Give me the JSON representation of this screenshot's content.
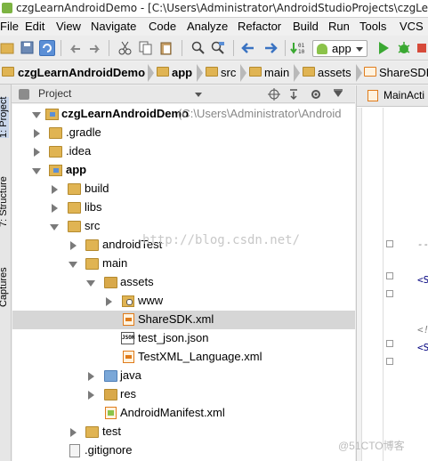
{
  "window": {
    "title": "czgLearnAndroidDemo - [C:\\Users\\Administrator\\AndroidStudioProjects\\czgLea"
  },
  "menu": [
    {
      "label": "File"
    },
    {
      "label": "Edit"
    },
    {
      "label": "View"
    },
    {
      "label": "Navigate"
    },
    {
      "label": "Code"
    },
    {
      "label": "Analyze"
    },
    {
      "label": "Refactor"
    },
    {
      "label": "Build"
    },
    {
      "label": "Run"
    },
    {
      "label": "Tools"
    },
    {
      "label": "VCS"
    }
  ],
  "toolbar": {
    "run_config": "app",
    "icons": [
      "open-folder-icon",
      "save-icon",
      "sync-icon",
      "undo-icon",
      "redo-icon",
      "cut-icon",
      "copy-icon",
      "paste-icon",
      "find-icon",
      "replace-icon",
      "back-icon",
      "forward-icon",
      "make-project-icon",
      "run-icon",
      "debug-icon"
    ]
  },
  "breadcrumb": [
    {
      "label": "czgLearnAndroidDemo",
      "bold": true
    },
    {
      "label": "app",
      "bold": true
    },
    {
      "label": "src",
      "bold": false
    },
    {
      "label": "main",
      "bold": false
    },
    {
      "label": "assets",
      "bold": false
    },
    {
      "label": "ShareSDK.",
      "bold": false
    }
  ],
  "sidetabs": {
    "project": "1: Project",
    "structure": "7: Structure",
    "captures": "Captures"
  },
  "panel": {
    "view_mode": "Project"
  },
  "tree": [
    {
      "label": "czgLearnAndroidDemo",
      "hint": "(C:\\Users\\Administrator\\Android",
      "bold": true,
      "depth": 0,
      "expand": "open",
      "icon": "module"
    },
    {
      "label": ".gradle",
      "depth": 1,
      "expand": "closed",
      "icon": "folder"
    },
    {
      "label": ".idea",
      "depth": 1,
      "expand": "closed",
      "icon": "folder"
    },
    {
      "label": "app",
      "bold": true,
      "depth": 1,
      "expand": "open",
      "icon": "module"
    },
    {
      "label": "build",
      "depth": 2,
      "expand": "closed",
      "icon": "folder"
    },
    {
      "label": "libs",
      "depth": 2,
      "expand": "closed",
      "icon": "folder"
    },
    {
      "label": "src",
      "depth": 2,
      "expand": "open",
      "icon": "folder"
    },
    {
      "label": "androidTest",
      "depth": 3,
      "expand": "closed",
      "icon": "folder"
    },
    {
      "label": "main",
      "depth": 3,
      "expand": "open",
      "icon": "folder"
    },
    {
      "label": "assets",
      "depth": 4,
      "expand": "open",
      "icon": "res"
    },
    {
      "label": "www",
      "depth": 5,
      "expand": "closed",
      "icon": "www"
    },
    {
      "label": "ShareSDK.xml",
      "depth": 5,
      "expand": "none",
      "icon": "xml",
      "selected": true
    },
    {
      "label": "test_json.json",
      "depth": 5,
      "expand": "none",
      "icon": "json"
    },
    {
      "label": "TestXML_Language.xml",
      "depth": 5,
      "expand": "none",
      "icon": "xml"
    },
    {
      "label": "java",
      "depth": 4,
      "expand": "closed",
      "icon": "java"
    },
    {
      "label": "res",
      "depth": 4,
      "expand": "closed",
      "icon": "res"
    },
    {
      "label": "AndroidManifest.xml",
      "depth": 4,
      "expand": "none",
      "icon": "manifest"
    },
    {
      "label": "test",
      "depth": 3,
      "expand": "closed",
      "icon": "folder"
    },
    {
      "label": ".gitignore",
      "depth": 2,
      "expand": "none",
      "icon": "gitignore"
    }
  ],
  "editor": {
    "tab": "MainActi",
    "lines": [
      {
        "text": "-->",
        "comment": true
      },
      {
        "text": "<Sh",
        "comment": false
      },
      {
        "text": "<!--",
        "comment": true
      },
      {
        "text": "<S",
        "comment": false
      }
    ]
  },
  "watermarks": {
    "blog": "http://blog.csdn.net/",
    "site": "@51CTO博客"
  },
  "colors": {
    "selection": "#d6d6d6",
    "folder": "#e0b453",
    "run": "#3aa832",
    "accent": "#5b8fd6"
  },
  "json_badge": "JSON"
}
